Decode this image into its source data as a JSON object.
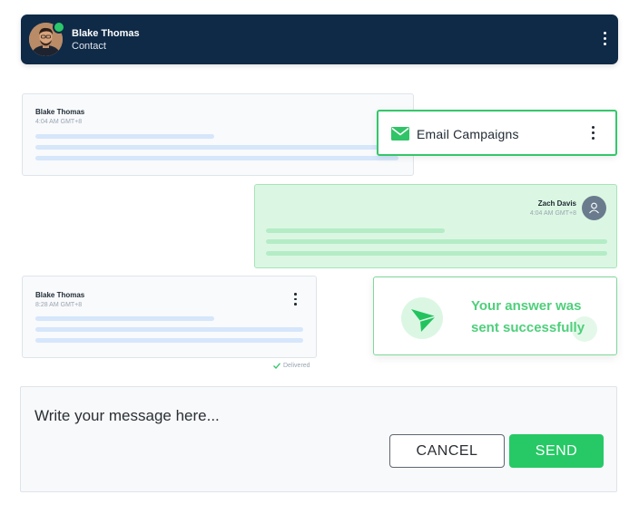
{
  "header": {
    "name": "Blake Thomas",
    "subtitle": "Contact",
    "avatar_icon": "user-avatar-photo",
    "status_color": "#2bc76a",
    "background_color": "#0f2a47"
  },
  "messages": [
    {
      "name": "Blake Thomas",
      "time": "4:04 AM GMT+8"
    },
    {
      "name": "Zach Davis",
      "time": "4:04 AM GMT+8"
    },
    {
      "name": "Blake Thomas",
      "time": "8:28 AM GMT+8",
      "status": "Delivered"
    }
  ],
  "email_campaigns": {
    "label": "Email Campaigns",
    "icon": "envelope-icon"
  },
  "success": {
    "line1": "Your answer was",
    "line2": "sent successfully",
    "icon": "paper-plane-icon"
  },
  "composer": {
    "placeholder": "Write your message here...",
    "cancel_label": "CANCEL",
    "send_label": "SEND"
  },
  "colors": {
    "accent_green": "#26c965",
    "navy": "#0f2a47",
    "placeholder_blue": "#d6e6fb"
  }
}
